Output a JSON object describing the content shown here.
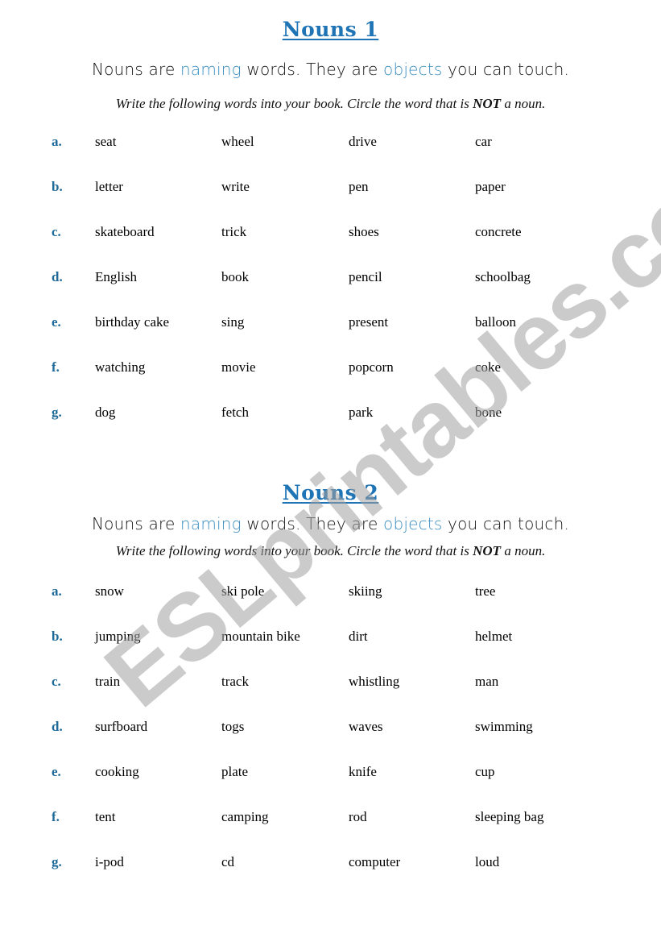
{
  "sections": [
    {
      "title": "Nouns 1",
      "lead": {
        "part1": "Nouns are ",
        "hl1": "naming",
        "part2": " words. They are ",
        "hl2": "objects",
        "part3": " you can touch."
      },
      "instruction": {
        "before": "Write the following words into your book. Circle the word that is ",
        "emphasis": "NOT",
        "after": " a noun."
      },
      "rows": [
        {
          "letter": "a.",
          "words": [
            "seat",
            "wheel",
            "drive",
            "car"
          ]
        },
        {
          "letter": "b.",
          "words": [
            "letter",
            "write",
            "pen",
            "paper"
          ]
        },
        {
          "letter": "c.",
          "words": [
            "skateboard",
            "trick",
            "shoes",
            "concrete"
          ]
        },
        {
          "letter": "d.",
          "words": [
            "English",
            "book",
            "pencil",
            "schoolbag"
          ]
        },
        {
          "letter": "e.",
          "words": [
            "birthday cake",
            "sing",
            "present",
            "balloon"
          ]
        },
        {
          "letter": "f.",
          "words": [
            "watching",
            "movie",
            "popcorn",
            "coke"
          ]
        },
        {
          "letter": "g.",
          "words": [
            "dog",
            "fetch",
            "park",
            "bone"
          ]
        }
      ]
    },
    {
      "title": "Nouns 2",
      "lead": {
        "part1": "Nouns are ",
        "hl1": "naming",
        "part2": " words. They are ",
        "hl2": "objects",
        "part3": " you can touch."
      },
      "instruction": {
        "before": "Write the following words into your book. Circle the word that is ",
        "emphasis": "NOT",
        "after": " a noun."
      },
      "rows": [
        {
          "letter": "a.",
          "words": [
            "snow",
            "ski pole",
            "skiing",
            "tree"
          ]
        },
        {
          "letter": "b.",
          "words": [
            "jumping",
            "mountain bike",
            "dirt",
            "helmet"
          ]
        },
        {
          "letter": "c.",
          "words": [
            "train",
            "track",
            "whistling",
            "man"
          ]
        },
        {
          "letter": "d.",
          "words": [
            "surfboard",
            "togs",
            "waves",
            "swimming"
          ]
        },
        {
          "letter": "e.",
          "words": [
            "cooking",
            "plate",
            "knife",
            "cup"
          ]
        },
        {
          "letter": "f.",
          "words": [
            "tent",
            "camping",
            "rod",
            "sleeping bag"
          ]
        },
        {
          "letter": "g.",
          "words": [
            "i-pod",
            "cd",
            "computer",
            "loud"
          ]
        }
      ]
    }
  ],
  "watermark": "ESLprintables.com",
  "colors": {
    "title": "#1f74b5",
    "highlight": "#3a8dbf",
    "letter": "#1f6a99",
    "watermark": "#a0a0a0"
  }
}
